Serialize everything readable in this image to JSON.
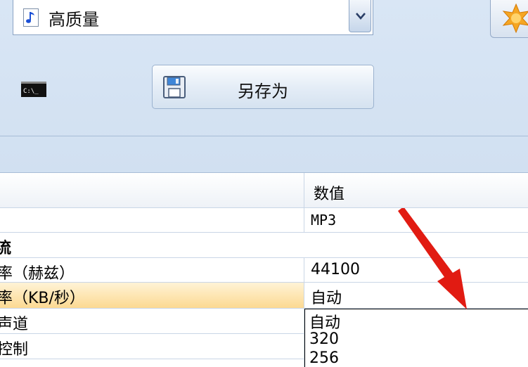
{
  "toolbar": {
    "preset_value": "高质量",
    "save_as_label": "另存为"
  },
  "properties": {
    "header_value": "数值",
    "rows": [
      {
        "name": "",
        "value": "MP3"
      },
      {
        "name": "流",
        "value": ""
      },
      {
        "name": "率（赫兹）",
        "value": "44100"
      },
      {
        "name": "率（KB/秒）",
        "value": "自动"
      },
      {
        "name": "声道",
        "value": ""
      },
      {
        "name": "控制",
        "value": ""
      }
    ]
  },
  "bitrate_dropdown": {
    "options": [
      "自动",
      "320",
      "256"
    ]
  },
  "colors": {
    "accent_red": "#e11b12",
    "highlight": "#fcd992"
  }
}
